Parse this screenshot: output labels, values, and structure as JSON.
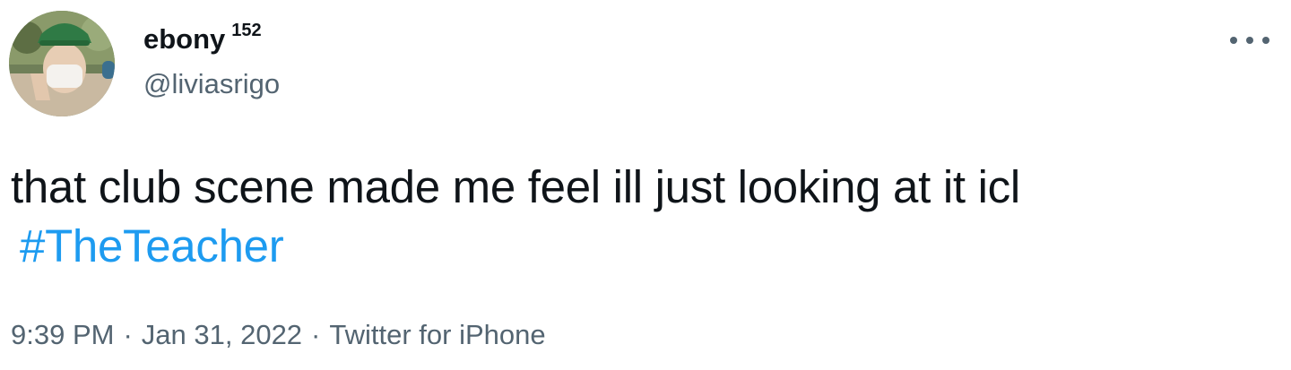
{
  "tweet": {
    "author": {
      "display_name": "ebony",
      "badge": "152",
      "handle": "@liviasrigo",
      "avatar_icon": "profile-photo"
    },
    "more_icon": "more-horizontal-icon",
    "text": "that club scene made me feel ill just looking at it icl",
    "hashtag": "#TheTeacher",
    "meta": {
      "time": "9:39 PM",
      "separator": "·",
      "date": "Jan 31, 2022",
      "source": "Twitter for iPhone"
    },
    "colors": {
      "text": "#0f1419",
      "secondary": "#536471",
      "link": "#1d9bf0"
    }
  }
}
